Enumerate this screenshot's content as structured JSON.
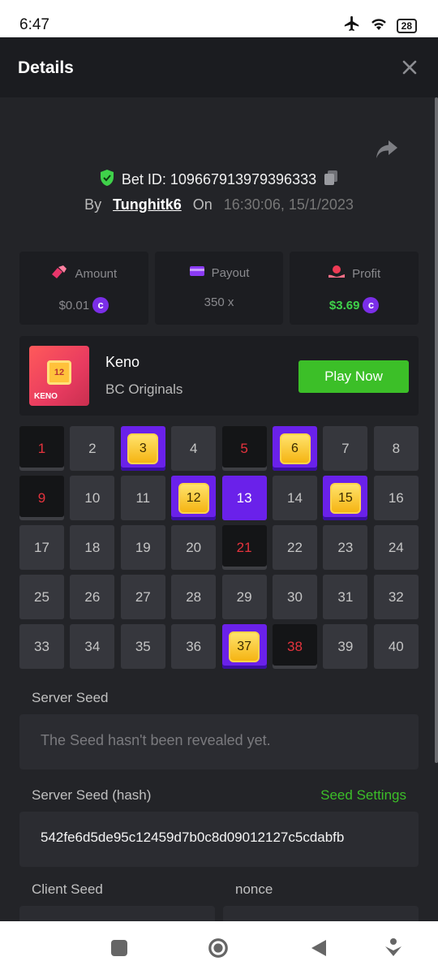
{
  "status": {
    "time": "6:47",
    "battery": "28"
  },
  "header": {
    "title": "Details"
  },
  "bet": {
    "id_label": "Bet ID: 109667913979396333",
    "by_label": "By",
    "username": "Tunghitk6",
    "on_label": "On",
    "datetime": "16:30:06, 15/1/2023"
  },
  "stats": {
    "amount": {
      "label": "Amount",
      "value": "$0.01"
    },
    "payout": {
      "label": "Payout",
      "value": "350 x"
    },
    "profit": {
      "label": "Profit",
      "value": "$3.69"
    }
  },
  "game": {
    "name": "Keno",
    "provider": "BC Originals",
    "thumb_number": "12",
    "thumb_label": "KENO",
    "play_label": "Play Now"
  },
  "grid": {
    "cells": [
      {
        "n": "1",
        "s": "drawn"
      },
      {
        "n": "2",
        "s": "normal"
      },
      {
        "n": "3",
        "s": "hit"
      },
      {
        "n": "4",
        "s": "normal"
      },
      {
        "n": "5",
        "s": "drawn"
      },
      {
        "n": "6",
        "s": "hit"
      },
      {
        "n": "7",
        "s": "normal"
      },
      {
        "n": "8",
        "s": "normal"
      },
      {
        "n": "9",
        "s": "drawn"
      },
      {
        "n": "10",
        "s": "normal"
      },
      {
        "n": "11",
        "s": "normal"
      },
      {
        "n": "12",
        "s": "hit"
      },
      {
        "n": "13",
        "s": "pick"
      },
      {
        "n": "14",
        "s": "normal"
      },
      {
        "n": "15",
        "s": "hit"
      },
      {
        "n": "16",
        "s": "normal"
      },
      {
        "n": "17",
        "s": "normal"
      },
      {
        "n": "18",
        "s": "normal"
      },
      {
        "n": "19",
        "s": "normal"
      },
      {
        "n": "20",
        "s": "normal"
      },
      {
        "n": "21",
        "s": "drawn"
      },
      {
        "n": "22",
        "s": "normal"
      },
      {
        "n": "23",
        "s": "normal"
      },
      {
        "n": "24",
        "s": "normal"
      },
      {
        "n": "25",
        "s": "normal"
      },
      {
        "n": "26",
        "s": "normal"
      },
      {
        "n": "27",
        "s": "normal"
      },
      {
        "n": "28",
        "s": "normal"
      },
      {
        "n": "29",
        "s": "normal"
      },
      {
        "n": "30",
        "s": "normal"
      },
      {
        "n": "31",
        "s": "normal"
      },
      {
        "n": "32",
        "s": "normal"
      },
      {
        "n": "33",
        "s": "normal"
      },
      {
        "n": "34",
        "s": "normal"
      },
      {
        "n": "35",
        "s": "normal"
      },
      {
        "n": "36",
        "s": "normal"
      },
      {
        "n": "37",
        "s": "hit"
      },
      {
        "n": "38",
        "s": "drawn"
      },
      {
        "n": "39",
        "s": "normal"
      },
      {
        "n": "40",
        "s": "normal"
      }
    ]
  },
  "seeds": {
    "server_seed_label": "Server Seed",
    "server_seed_value": "The Seed hasn't been revealed yet.",
    "server_hash_label": "Server Seed (hash)",
    "seed_settings_label": "Seed Settings",
    "server_hash_value": "542fe6d5de95c12459d7b0c8d09012127c5cdabfb",
    "client_seed_label": "Client Seed",
    "nonce_label": "nonce"
  },
  "colors": {
    "accent_green": "#3cbf28",
    "pick_purple": "#6a21ea",
    "coin_purple": "#7b2ee8",
    "loss_red": "#e5333d"
  }
}
